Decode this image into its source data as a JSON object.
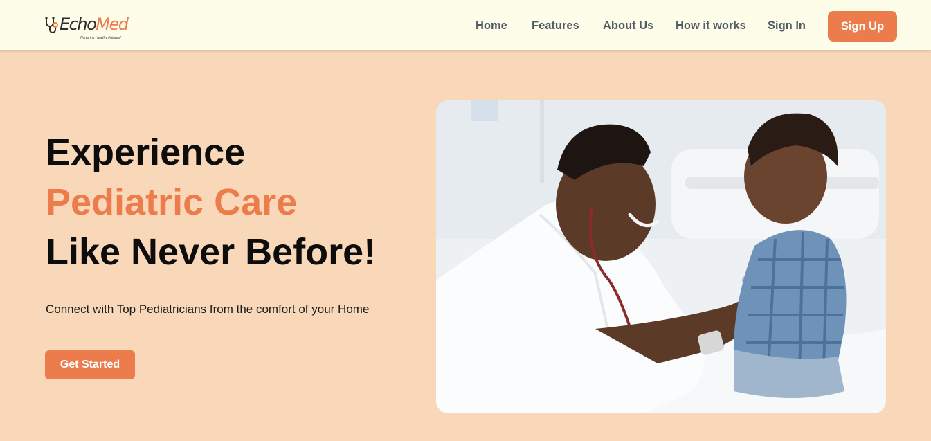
{
  "brand": {
    "name_part1": "Echo",
    "name_part2": "Med",
    "tagline": "Nurturing Healthy Futures!",
    "accent_color": "#ec7c4c",
    "nav_bg": "#fefde9",
    "page_bg": "#f8d8b9"
  },
  "nav": {
    "links": [
      "Home",
      "Features",
      "About Us",
      "How it works",
      "Sign In"
    ],
    "signup_label": "Sign Up"
  },
  "hero": {
    "title_line1": "Experience",
    "title_line2": "Pediatric Care",
    "title_line3": "Like Never Before!",
    "subtitle": "Connect with Top Pediatricians from the comfort of your Home",
    "cta_label": "Get Started",
    "image_icon": "doctor-with-child-photo"
  }
}
